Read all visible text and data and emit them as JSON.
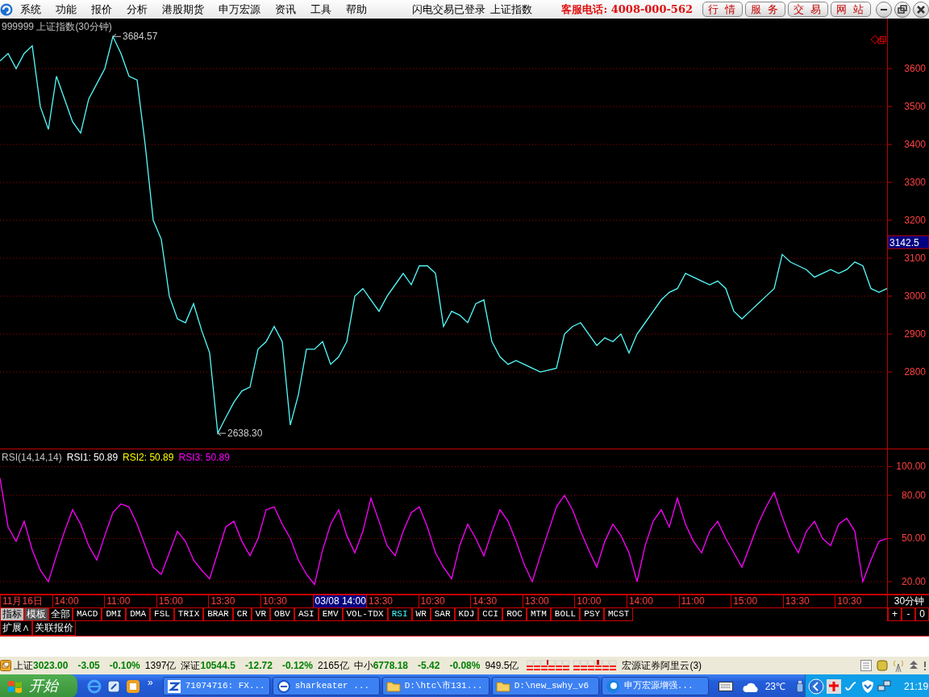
{
  "menu_bar": {
    "items": [
      "系统",
      "功能",
      "报价",
      "分析",
      "港股期货",
      "申万宏源",
      "资讯",
      "工具",
      "帮助"
    ],
    "login_status": "闪电交易已登录",
    "current_index": "上证指数",
    "hotline": "客服电话: 4008-000-562",
    "buttons": [
      "行情",
      "服务",
      "交易",
      "网站"
    ]
  },
  "price_pane": {
    "title": "999999 上证指数(30分钟)",
    "current_price": "3142.5",
    "chart_data": {
      "type": "line",
      "grid": true,
      "ylim": [
        2596,
        3732
      ],
      "yticks": [
        2800,
        2900,
        3000,
        3100,
        3200,
        3300,
        3400,
        3500,
        3600
      ],
      "series": [
        {
          "color": "#54fcfc",
          "values": [
            3620,
            3640,
            3600,
            3640,
            3660,
            3500,
            3440,
            3580,
            3520,
            3460,
            3430,
            3520,
            3560,
            3600,
            3684.57,
            3640,
            3580,
            3570,
            3400,
            3200,
            3150,
            3000,
            2940,
            2930,
            2980,
            2910,
            2850,
            2638.3,
            2680,
            2720,
            2750,
            2760,
            2860,
            2880,
            2920,
            2880,
            2660,
            2740,
            2860,
            2860,
            2880,
            2820,
            2840,
            2880,
            3000,
            3020,
            2990,
            2960,
            3000,
            3030,
            3060,
            3030,
            3080,
            3080,
            3060,
            2920,
            2960,
            2950,
            2930,
            2980,
            2990,
            2880,
            2840,
            2820,
            2830,
            2820,
            2810,
            2800,
            2805,
            2810,
            2900,
            2920,
            2930,
            2900,
            2870,
            2890,
            2880,
            2900,
            2850,
            2900,
            2930,
            2960,
            2990,
            3010,
            3020,
            3060,
            3050,
            3040,
            3030,
            3040,
            3020,
            2960,
            2940,
            2960,
            2980,
            3000,
            3020,
            3110,
            3090,
            3080,
            3070,
            3050,
            3060,
            3070,
            3060,
            3070,
            3090,
            3080,
            3020,
            3010,
            3020
          ]
        }
      ],
      "annotations": [
        "3684.57",
        "2638.30"
      ]
    }
  },
  "rsi_pane": {
    "title": "RSI(14,14,14)",
    "legend": [
      {
        "text": "RSI1: 50.89",
        "color": "#ffffff"
      },
      {
        "text": "RSI2: 50.89",
        "color": "#ffff00"
      },
      {
        "text": "RSI3: 50.89",
        "color": "#ff00ff"
      }
    ],
    "chart_data": {
      "type": "line",
      "grid": true,
      "ylim": [
        11,
        112
      ],
      "yticks": [
        {
          "value": 20,
          "label": "20.00"
        },
        {
          "value": 50,
          "label": "50.00"
        },
        {
          "value": 80,
          "label": "80.00"
        },
        {
          "value": 100,
          "label": "100.00"
        }
      ],
      "series": [
        {
          "color": "#ff00ff",
          "values": [
            92,
            58,
            48,
            62,
            42,
            28,
            20,
            38,
            55,
            70,
            60,
            45,
            35,
            52,
            68,
            74,
            72,
            60,
            45,
            30,
            25,
            40,
            55,
            48,
            35,
            28,
            22,
            40,
            58,
            62,
            48,
            38,
            50,
            70,
            72,
            60,
            50,
            35,
            25,
            18,
            42,
            60,
            70,
            52,
            40,
            55,
            78,
            62,
            45,
            38,
            55,
            68,
            72,
            58,
            40,
            30,
            22,
            45,
            60,
            50,
            38,
            55,
            70,
            62,
            48,
            32,
            20,
            38,
            55,
            72,
            80,
            70,
            55,
            42,
            30,
            48,
            60,
            52,
            40,
            20,
            45,
            62,
            70,
            58,
            78,
            60,
            48,
            40,
            55,
            62,
            50,
            40,
            30,
            45,
            60,
            72,
            82,
            65,
            50,
            40,
            55,
            62,
            50,
            45,
            60,
            64,
            55,
            20,
            35,
            48,
            50
          ]
        }
      ]
    }
  },
  "time_axis": {
    "labels": [
      {
        "text": "11月16日",
        "selected": false
      },
      {
        "text": "14:00",
        "selected": false
      },
      {
        "text": "11:00",
        "selected": false
      },
      {
        "text": "15:00",
        "selected": false
      },
      {
        "text": "13:30",
        "selected": false
      },
      {
        "text": "10:30",
        "selected": false
      },
      {
        "text": "03/08 14:00",
        "selected": true
      },
      {
        "text": "13:30",
        "selected": false
      },
      {
        "text": "10:30",
        "selected": false
      },
      {
        "text": "14:30",
        "selected": false
      },
      {
        "text": "13:00",
        "selected": false
      },
      {
        "text": "10:00",
        "selected": false
      },
      {
        "text": "14:00",
        "selected": false
      },
      {
        "text": "11:00",
        "selected": false
      },
      {
        "text": "15:00",
        "selected": false
      },
      {
        "text": "13:30",
        "selected": false
      },
      {
        "text": "10:30",
        "selected": false
      }
    ],
    "period": "30分钟"
  },
  "view_tabs": [
    {
      "label": "指标",
      "selected": true
    },
    {
      "label": "模板",
      "selected": false
    },
    {
      "label": "全部",
      "selected": false
    }
  ],
  "indicator_tabs": [
    {
      "label": "MACD",
      "selected": false
    },
    {
      "label": "DMI",
      "selected": false
    },
    {
      "label": "DMA",
      "selected": false
    },
    {
      "label": "FSL",
      "selected": false
    },
    {
      "label": "TRIX",
      "selected": false
    },
    {
      "label": "BRAR",
      "selected": false
    },
    {
      "label": "CR",
      "selected": false
    },
    {
      "label": "VR",
      "selected": false
    },
    {
      "label": "OBV",
      "selected": false
    },
    {
      "label": "ASI",
      "selected": false
    },
    {
      "label": "EMV",
      "selected": false
    },
    {
      "label": "VOL-TDX",
      "selected": false
    },
    {
      "label": "RSI",
      "selected": true
    },
    {
      "label": "WR",
      "selected": false
    },
    {
      "label": "SAR",
      "selected": false
    },
    {
      "label": "KDJ",
      "selected": false
    },
    {
      "label": "CCI",
      "selected": false
    },
    {
      "label": "ROC",
      "selected": false
    },
    {
      "label": "MTM",
      "selected": false
    },
    {
      "label": "BOLL",
      "selected": false
    },
    {
      "label": "PSY",
      "selected": false
    },
    {
      "label": "MCST",
      "selected": false
    }
  ],
  "zoom_buttons": [
    "+",
    "-",
    "0"
  ],
  "extra_tabs": [
    "扩展∧",
    "关联报价"
  ],
  "status_bar": {
    "indices": [
      {
        "name": "上证",
        "value": "3023.00",
        "change": "-3.05",
        "percent": "-0.10%",
        "amount": "1397亿"
      },
      {
        "name": "深证",
        "value": "10544.5",
        "change": "-12.72",
        "percent": "-0.12%",
        "amount": "2165亿"
      },
      {
        "name": "中小",
        "value": "6778.18",
        "change": "-5.42",
        "percent": "-0.08%",
        "amount": "949.5亿"
      }
    ],
    "broker": "宏源证券阿里云(3)"
  },
  "taskbar": {
    "start": "开始",
    "more": "»",
    "tasks": [
      {
        "label": "71074716: FX...",
        "kind": "app"
      },
      {
        "label": "sharkeater ...",
        "kind": "browser"
      },
      {
        "label": "D:\\htc\\市131...",
        "kind": "folder"
      },
      {
        "label": "D:\\new_swhy_v6",
        "kind": "folder"
      },
      {
        "label": "申万宏源增强...",
        "kind": "swirl"
      }
    ],
    "temperature": "23℃",
    "clock": "21:19"
  }
}
